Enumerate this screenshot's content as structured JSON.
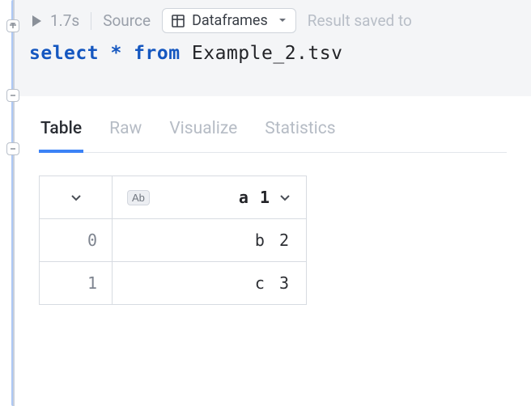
{
  "header": {
    "run_time": "1.7s",
    "source_label": "Source",
    "dataframes_label": "Dataframes",
    "result_saved": "Result saved to"
  },
  "code": {
    "kw_select": "select",
    "star": "*",
    "kw_from": "from",
    "table_name": "Example_2.tsv"
  },
  "tabs": {
    "table": "Table",
    "raw": "Raw",
    "visualize": "Visualize",
    "statistics": "Statistics"
  },
  "grid": {
    "col_type_badge": "Ab",
    "col_name": "a 1",
    "rows": [
      {
        "idx": "0",
        "val": "b 2"
      },
      {
        "idx": "1",
        "val": "c 3"
      }
    ]
  }
}
